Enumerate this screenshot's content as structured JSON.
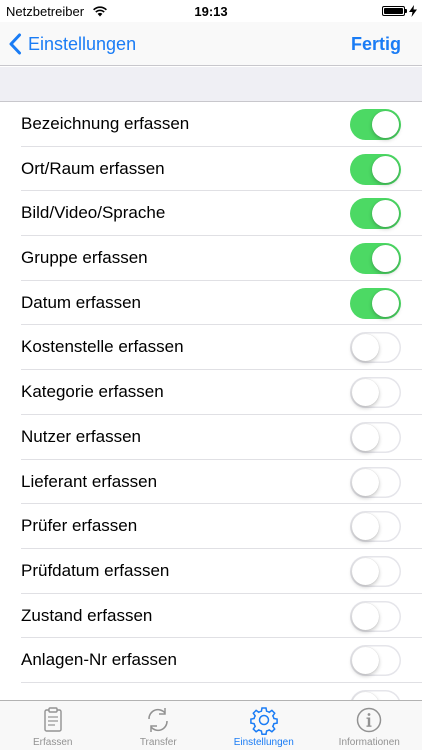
{
  "status_bar": {
    "carrier": "Netzbetreiber",
    "time": "19:13"
  },
  "nav": {
    "back_label": "Einstellungen",
    "done_label": "Fertig"
  },
  "settings": [
    {
      "label": "Bezeichnung erfassen",
      "on": true
    },
    {
      "label": "Ort/Raum erfassen",
      "on": true
    },
    {
      "label": "Bild/Video/Sprache",
      "on": true
    },
    {
      "label": "Gruppe erfassen",
      "on": true
    },
    {
      "label": "Datum erfassen",
      "on": true
    },
    {
      "label": "Kostenstelle erfassen",
      "on": false
    },
    {
      "label": "Kategorie erfassen",
      "on": false
    },
    {
      "label": "Nutzer erfassen",
      "on": false
    },
    {
      "label": "Lieferant erfassen",
      "on": false
    },
    {
      "label": "Prüfer erfassen",
      "on": false
    },
    {
      "label": "Prüfdatum erfassen",
      "on": false
    },
    {
      "label": "Zustand erfassen",
      "on": false
    },
    {
      "label": "Anlagen-Nr erfassen",
      "on": false
    },
    {
      "label": "",
      "on": false
    }
  ],
  "tabs": [
    {
      "label": "Erfassen",
      "icon": "clipboard-icon",
      "active": false
    },
    {
      "label": "Transfer",
      "icon": "sync-icon",
      "active": false
    },
    {
      "label": "Einstellungen",
      "icon": "gear-icon",
      "active": true
    },
    {
      "label": "Informationen",
      "icon": "info-icon",
      "active": false
    }
  ],
  "colors": {
    "accent": "#1a7cf5",
    "toggle_on": "#4cd964",
    "tab_inactive": "#929292"
  }
}
